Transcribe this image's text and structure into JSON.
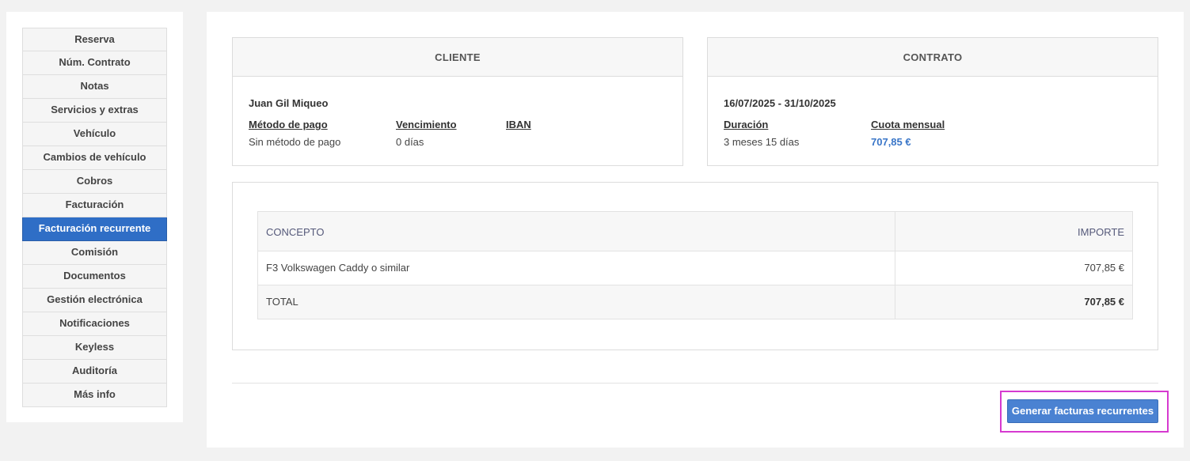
{
  "sidebar": {
    "items": [
      {
        "label": "Reserva"
      },
      {
        "label": "Núm. Contrato"
      },
      {
        "label": "Notas"
      },
      {
        "label": "Servicios y extras"
      },
      {
        "label": "Vehículo"
      },
      {
        "label": "Cambios de vehículo"
      },
      {
        "label": "Cobros"
      },
      {
        "label": "Facturación"
      },
      {
        "label": "Facturación recurrente",
        "active": true
      },
      {
        "label": "Comisión"
      },
      {
        "label": "Documentos"
      },
      {
        "label": "Gestión electrónica"
      },
      {
        "label": "Notificaciones"
      },
      {
        "label": "Keyless"
      },
      {
        "label": "Auditoría"
      },
      {
        "label": "Más info"
      }
    ]
  },
  "cliente": {
    "title": "CLIENTE",
    "name": "Juan Gil Miqueo",
    "metodo_label": "Método de pago",
    "metodo_value": "Sin método de pago",
    "vencimiento_label": "Vencimiento",
    "vencimiento_value": "0 días",
    "iban_label": "IBAN",
    "iban_value": ""
  },
  "contrato": {
    "title": "CONTRATO",
    "period": "16/07/2025 - 31/10/2025",
    "duracion_label": "Duración",
    "duracion_value": "3 meses 15 días",
    "cuota_label": "Cuota mensual",
    "cuota_value": "707,85 €"
  },
  "table": {
    "headers": {
      "concepto": "CONCEPTO",
      "importe": "IMPORTE"
    },
    "rows": [
      {
        "concepto": "F3 Volkswagen Caddy o similar",
        "importe": "707,85 €"
      }
    ],
    "total": {
      "label": "TOTAL",
      "value": "707,85 €"
    }
  },
  "actions": {
    "generate_label": "Generar facturas recurrentes"
  },
  "colors": {
    "accent": "#2f6ec6",
    "button": "#4a82d2",
    "highlight": "#d63ad0"
  }
}
